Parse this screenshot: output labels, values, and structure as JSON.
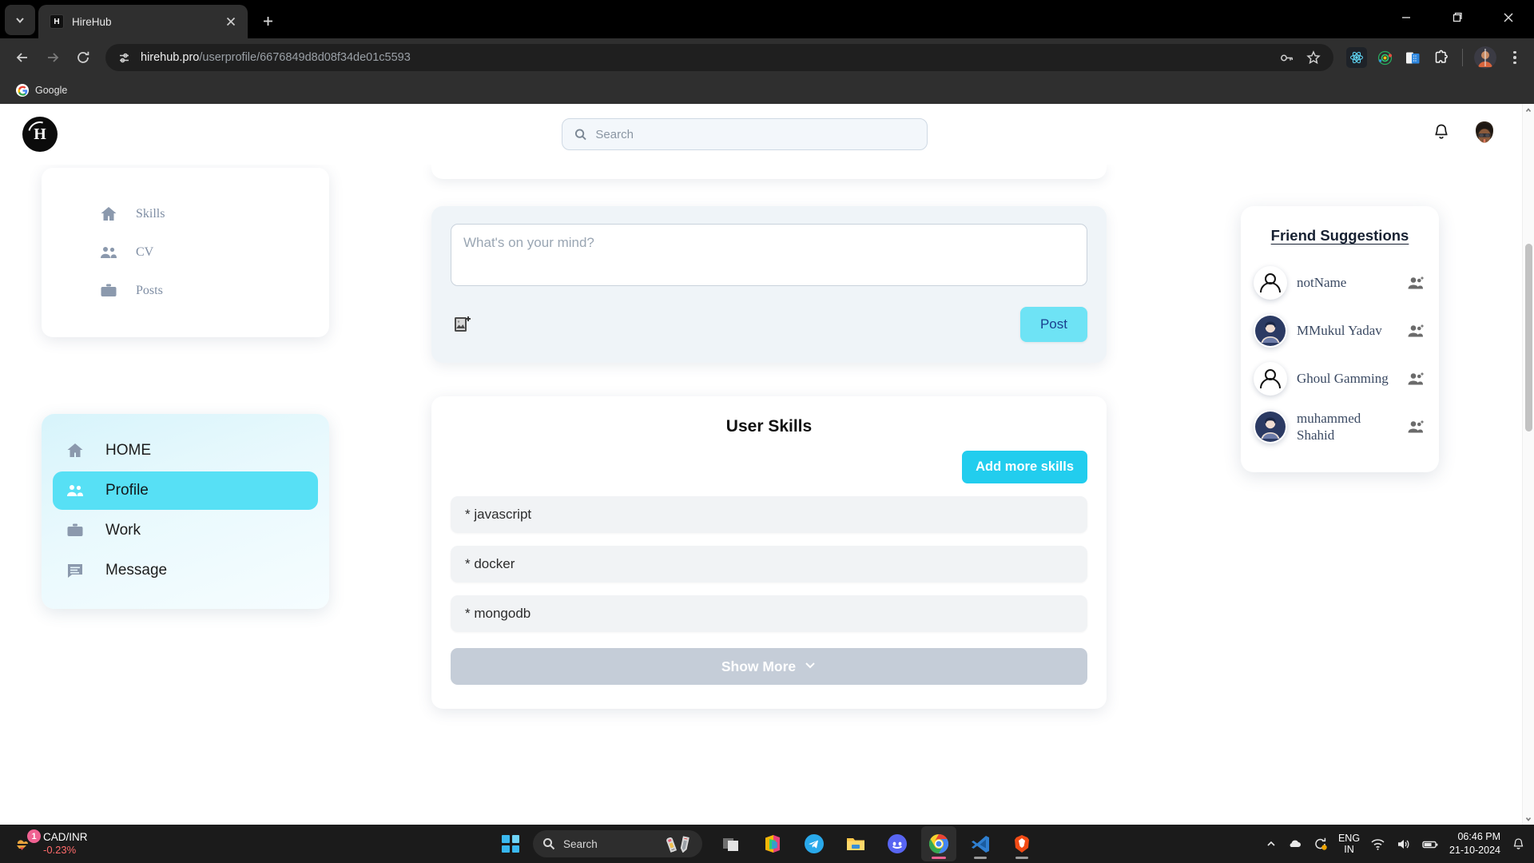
{
  "browser": {
    "tab": {
      "title": "HireHub",
      "favicon_letter": "H"
    },
    "url": {
      "host": "hirehub.pro",
      "path": "/userprofile/6676849d8d08f34de01c5593"
    },
    "omnibox_icons": [
      "passkey-icon",
      "bookmark-star-icon"
    ],
    "toolbar_icons": [
      "react-devtools-icon",
      "redux-devtools-icon",
      "device-toolbar-icon",
      "extensions-puzzle-icon",
      "browser-profile-avatar",
      "three-dot-menu-icon"
    ],
    "bookmarks": [
      {
        "label": "Google",
        "icon": "google-icon"
      }
    ],
    "window_controls": [
      "minimize",
      "maximize",
      "close"
    ]
  },
  "app": {
    "logo_letter": "H",
    "search": {
      "placeholder": "Search",
      "value": ""
    },
    "header_icons": [
      "notification-bell-icon",
      "user-avatar"
    ]
  },
  "profile_subnav": {
    "items": [
      {
        "label": "Skills",
        "icon": "home-icon"
      },
      {
        "label": "CV",
        "icon": "people-icon"
      },
      {
        "label": "Posts",
        "icon": "briefcase-icon"
      }
    ]
  },
  "main_nav": {
    "items": [
      {
        "label": "HOME",
        "icon": "home-icon",
        "active": false
      },
      {
        "label": "Profile",
        "icon": "people-icon",
        "active": true
      },
      {
        "label": "Work",
        "icon": "briefcase-icon",
        "active": false
      },
      {
        "label": "Message",
        "icon": "message-icon",
        "active": false
      }
    ]
  },
  "composer": {
    "placeholder": "What's on your mind?",
    "value": "",
    "add_image_icon": "add-image-icon",
    "post_label": "Post"
  },
  "skills": {
    "title": "User Skills",
    "add_label": "Add more skills",
    "items": [
      "* javascript",
      "* docker",
      "* mongodb"
    ],
    "show_more_label": "Show More"
  },
  "friends": {
    "title": "Friend Suggestions",
    "items": [
      {
        "name": "notName",
        "avatar": "default-avatar"
      },
      {
        "name": "MMukul Yadav",
        "avatar": "photo-avatar"
      },
      {
        "name": "Ghoul Gamming",
        "avatar": "default-avatar"
      },
      {
        "name": "muhammed Shahid",
        "avatar": "photo-avatar"
      }
    ],
    "action_icon": "add-friend-icon"
  },
  "taskbar": {
    "widget": {
      "badge": "1",
      "pair": "CAD/INR",
      "change": "-0.23%"
    },
    "search_placeholder": "Search",
    "apps": [
      "task-view-icon",
      "office-icon",
      "telegram-icon",
      "file-explorer-icon",
      "discord-icon",
      "chrome-icon",
      "vscode-icon",
      "brave-icon"
    ],
    "tray": {
      "language": "ENG",
      "region": "IN",
      "time": "06:46 PM",
      "date": "21-10-2024",
      "icons": [
        "chevron-up-icon",
        "cloud-icon",
        "sync-icon",
        "wifi-icon",
        "volume-icon",
        "battery-icon",
        "notification-bell-icon"
      ]
    }
  },
  "colors": {
    "accent_cyan": "#22cdee",
    "post_cyan": "#6ee3f5",
    "nav_active": "#57e0f5",
    "muted_icon": "#8b99ad"
  }
}
